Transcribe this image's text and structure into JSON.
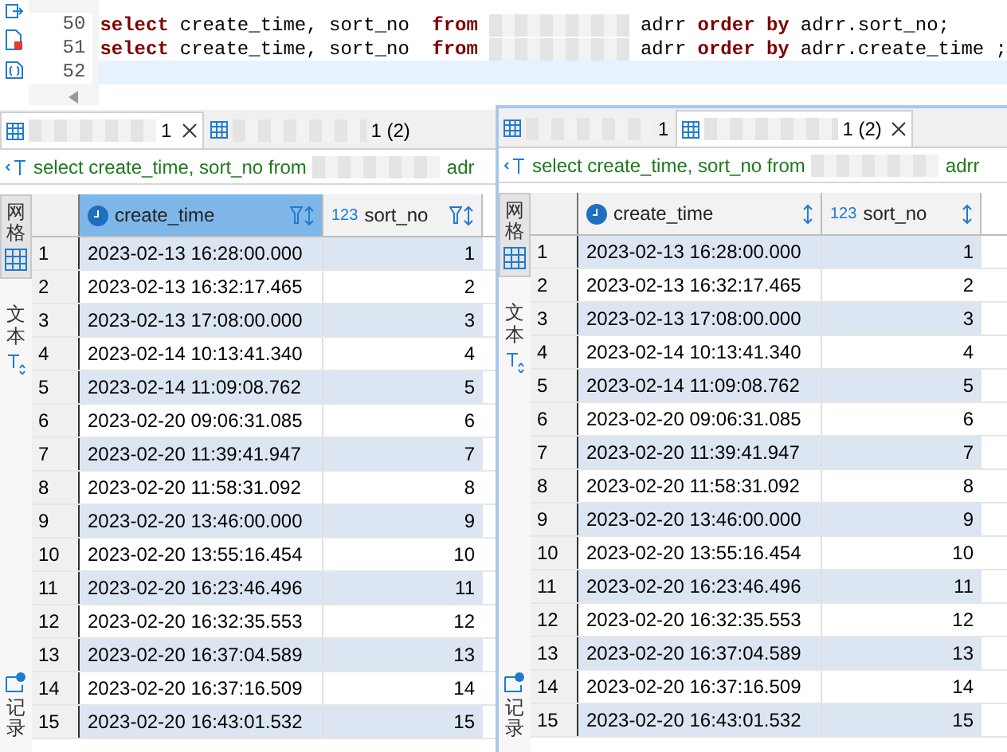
{
  "editor": {
    "lines": [
      {
        "number": "50",
        "parts": [
          {
            "kind": "keyword",
            "text": "select"
          },
          {
            "kind": "plain",
            "text": "create_time, sort_no "
          },
          {
            "kind": "keyword",
            "text": "from"
          },
          {
            "kind": "redacted"
          },
          {
            "kind": "plain",
            "text": "adrr"
          },
          {
            "kind": "keyword",
            "text": "order by"
          },
          {
            "kind": "plain",
            "text": "adrr.sort_no;"
          }
        ]
      },
      {
        "number": "51",
        "parts": [
          {
            "kind": "keyword",
            "text": "select"
          },
          {
            "kind": "plain",
            "text": "create_time, sort_no "
          },
          {
            "kind": "keyword",
            "text": "from"
          },
          {
            "kind": "redacted"
          },
          {
            "kind": "plain",
            "text": "adrr"
          },
          {
            "kind": "keyword",
            "text": "order by"
          },
          {
            "kind": "plain",
            "text": "adrr.create_time ;"
          }
        ]
      },
      {
        "number": "52"
      }
    ]
  },
  "panels": [
    {
      "tabs": [
        {
          "label": "1",
          "selected": true
        },
        {
          "label": "1 (2)",
          "selected": false
        }
      ],
      "query": {
        "prefix": "select create_time, sort_no from",
        "suffix": "adr"
      },
      "side_tabs": [
        {
          "label": "网格",
          "selected": true,
          "kind": "grid"
        },
        {
          "label": "文本",
          "selected": false,
          "kind": "text"
        },
        {
          "label": "记录",
          "selected": false,
          "kind": "record"
        }
      ],
      "columns": [
        {
          "label": "create_time",
          "kind": "time",
          "selected": true,
          "filter": true
        },
        {
          "label": "sort_no",
          "kind": "number",
          "type_label": "123",
          "selected": false,
          "filter": true
        }
      ],
      "rows": [
        {
          "n": "1",
          "create_time": "2023-02-13 16:28:00.000",
          "sort_no": "1"
        },
        {
          "n": "2",
          "create_time": "2023-02-13 16:32:17.465",
          "sort_no": "2"
        },
        {
          "n": "3",
          "create_time": "2023-02-13 17:08:00.000",
          "sort_no": "3"
        },
        {
          "n": "4",
          "create_time": "2023-02-14 10:13:41.340",
          "sort_no": "4"
        },
        {
          "n": "5",
          "create_time": "2023-02-14 11:09:08.762",
          "sort_no": "5"
        },
        {
          "n": "6",
          "create_time": "2023-02-20 09:06:31.085",
          "sort_no": "6"
        },
        {
          "n": "7",
          "create_time": "2023-02-20 11:39:41.947",
          "sort_no": "7"
        },
        {
          "n": "8",
          "create_time": "2023-02-20 11:58:31.092",
          "sort_no": "8"
        },
        {
          "n": "9",
          "create_time": "2023-02-20 13:46:00.000",
          "sort_no": "9"
        },
        {
          "n": "10",
          "create_time": "2023-02-20 13:55:16.454",
          "sort_no": "10"
        },
        {
          "n": "11",
          "create_time": "2023-02-20 16:23:46.496",
          "sort_no": "11"
        },
        {
          "n": "12",
          "create_time": "2023-02-20 16:32:35.553",
          "sort_no": "12"
        },
        {
          "n": "13",
          "create_time": "2023-02-20 16:37:04.589",
          "sort_no": "13"
        },
        {
          "n": "14",
          "create_time": "2023-02-20 16:37:16.509",
          "sort_no": "14"
        },
        {
          "n": "15",
          "create_time": "2023-02-20 16:43:01.532",
          "sort_no": "15"
        }
      ]
    },
    {
      "tabs": [
        {
          "label": "1",
          "selected": false
        },
        {
          "label": "1 (2)",
          "selected": true
        }
      ],
      "query": {
        "prefix": "select create_time, sort_no from",
        "suffix": "adrr"
      },
      "side_tabs": [
        {
          "label": "网格",
          "selected": true,
          "kind": "grid"
        },
        {
          "label": "文本",
          "selected": false,
          "kind": "text"
        },
        {
          "label": "记录",
          "selected": false,
          "kind": "record"
        }
      ],
      "columns": [
        {
          "label": "create_time",
          "kind": "time",
          "selected": false,
          "filter": false
        },
        {
          "label": "sort_no",
          "kind": "number",
          "type_label": "123",
          "selected": false,
          "filter": false
        }
      ],
      "rows": [
        {
          "n": "1",
          "create_time": "2023-02-13 16:28:00.000",
          "sort_no": "1"
        },
        {
          "n": "2",
          "create_time": "2023-02-13 16:32:17.465",
          "sort_no": "2"
        },
        {
          "n": "3",
          "create_time": "2023-02-13 17:08:00.000",
          "sort_no": "3"
        },
        {
          "n": "4",
          "create_time": "2023-02-14 10:13:41.340",
          "sort_no": "4"
        },
        {
          "n": "5",
          "create_time": "2023-02-14 11:09:08.762",
          "sort_no": "5"
        },
        {
          "n": "6",
          "create_time": "2023-02-20 09:06:31.085",
          "sort_no": "6"
        },
        {
          "n": "7",
          "create_time": "2023-02-20 11:39:41.947",
          "sort_no": "7"
        },
        {
          "n": "8",
          "create_time": "2023-02-20 11:58:31.092",
          "sort_no": "8"
        },
        {
          "n": "9",
          "create_time": "2023-02-20 13:46:00.000",
          "sort_no": "9"
        },
        {
          "n": "10",
          "create_time": "2023-02-20 13:55:16.454",
          "sort_no": "10"
        },
        {
          "n": "11",
          "create_time": "2023-02-20 16:23:46.496",
          "sort_no": "11"
        },
        {
          "n": "12",
          "create_time": "2023-02-20 16:32:35.553",
          "sort_no": "12"
        },
        {
          "n": "13",
          "create_time": "2023-02-20 16:37:04.589",
          "sort_no": "13"
        },
        {
          "n": "14",
          "create_time": "2023-02-20 16:37:16.509",
          "sort_no": "14"
        },
        {
          "n": "15",
          "create_time": "2023-02-20 16:43:01.532",
          "sort_no": "15"
        }
      ]
    }
  ]
}
